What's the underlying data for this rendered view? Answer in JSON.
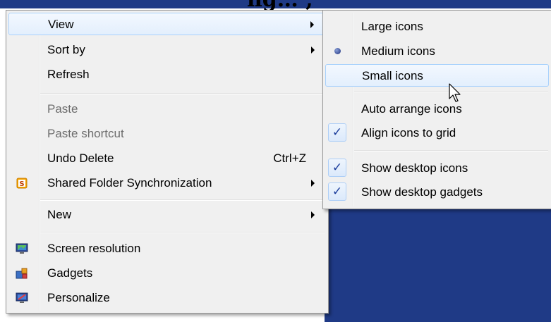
{
  "title_fragment": "ng… ,",
  "main_menu": {
    "items": [
      {
        "label": "View"
      },
      {
        "label": "Sort by"
      },
      {
        "label": "Refresh"
      },
      {
        "label": "Paste"
      },
      {
        "label": "Paste shortcut"
      },
      {
        "label": "Undo Delete",
        "shortcut": "Ctrl+Z"
      },
      {
        "label": "Shared Folder Synchronization",
        "icon": "shared-folder-sync-icon"
      },
      {
        "label": "New"
      },
      {
        "label": "Screen resolution",
        "icon": "screen-resolution-icon"
      },
      {
        "label": "Gadgets",
        "icon": "gadgets-icon"
      },
      {
        "label": "Personalize",
        "icon": "personalize-icon"
      }
    ]
  },
  "view_submenu": {
    "items": [
      {
        "label": "Large icons"
      },
      {
        "label": "Medium icons",
        "selected": true
      },
      {
        "label": "Small icons",
        "hovered": true
      },
      {
        "label": "Auto arrange icons",
        "checked": false
      },
      {
        "label": "Align icons to grid",
        "checked": true
      },
      {
        "label": "Show desktop icons",
        "checked": true
      },
      {
        "label": "Show desktop gadgets",
        "checked": true
      }
    ]
  },
  "glyphs": {
    "check": "✓"
  }
}
